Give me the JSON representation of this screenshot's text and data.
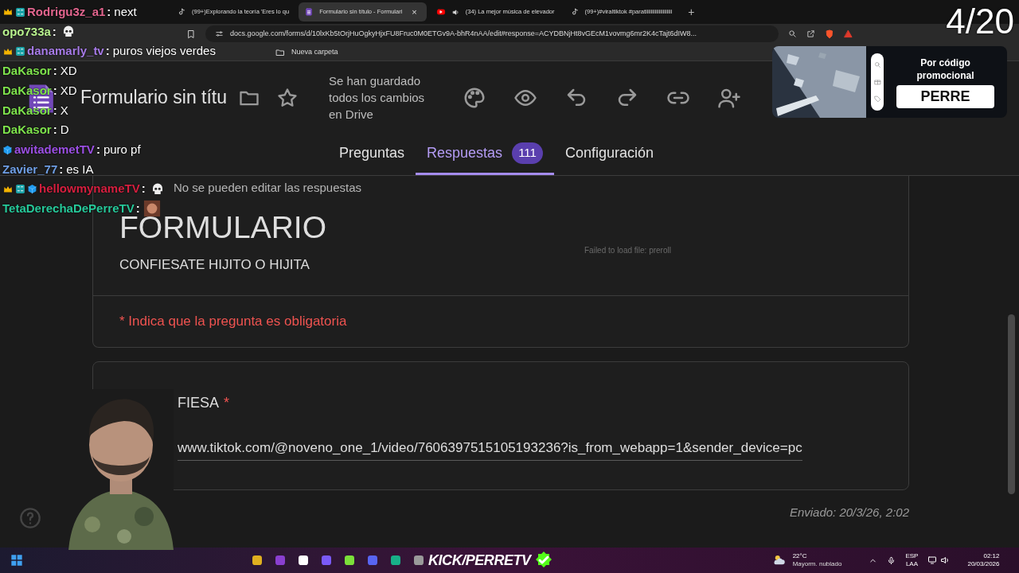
{
  "browser": {
    "tabs": [
      {
        "kind": "tiktok",
        "label": "(99+)Explorando la teoría 'Eres lo qu",
        "selected": false
      },
      {
        "kind": "forms",
        "label": "Formulario sin título - Formulari",
        "selected": true,
        "close": "×"
      },
      {
        "kind": "youtube",
        "label": "(34) La mejor música de elevador",
        "selected": false
      },
      {
        "kind": "tiktok",
        "label": "(99+)#viraltiktok #paratiiiiiiiiiiiiiiiiiiii",
        "selected": false
      }
    ],
    "new_tab": "+",
    "address": "docs.google.com/forms/d/10lxKb5tOrjHuOgkyHjxFU8Fruc0M0ETGv9A-bhR4nAA/edit#response=ACYDBNjHt8vGEcM1vovmg6mr2K4cTajt6dIW8...",
    "bookmarks": [
      "Nueva carpeta"
    ]
  },
  "form_header": {
    "title": "Formulario sin títu",
    "save_status": "Se han guardado todos los cambios en Drive",
    "tabs": [
      {
        "label": "Preguntas",
        "selected": false
      },
      {
        "label": "Respuestas",
        "selected": true,
        "count": "111"
      },
      {
        "label": "Configuración",
        "selected": false
      }
    ]
  },
  "response": {
    "note": "No se pueden editar las respuestas",
    "title": "FORMULARIO",
    "description": "CONFIESATE HIJITO O HIJITA",
    "required_note": "* Indica que la pregunta es obligatoria",
    "faint_message": "Failed to load file: preroll",
    "question": {
      "label": "FIESA",
      "required_mark": "*",
      "answer": "www.tiktok.com/@noveno_one_1/video/7606397515105193236?is_from_webapp=1&sender_device=pc"
    },
    "submitted": "Enviado: 20/3/26, 2:02"
  },
  "stream_overlay": {
    "chat": [
      {
        "user": "Rodrigu3z_a1",
        "color": "#e2658e",
        "separator": ":",
        "message": "next"
      },
      {
        "user": "opo733a",
        "color": "#b8f28e",
        "separator": ":"
      },
      {
        "user": "danamarly_tv",
        "color": "#a77be8",
        "separator": ":",
        "message": "puros viejos verdes"
      },
      {
        "user": "DaKasor",
        "color": "#7ee34c",
        "separator": ":",
        "message": "XD"
      },
      {
        "user": "DaKasor",
        "color": "#7ee34c",
        "separator": ":",
        "message": "XD"
      },
      {
        "user": "DaKasor",
        "color": "#7ee34c",
        "separator": ":",
        "message": "X"
      },
      {
        "user": "DaKasor",
        "color": "#7ee34c",
        "separator": ":",
        "message": "D"
      },
      {
        "user": "awitademetTV",
        "color": "#9b4fe3",
        "separator": ":",
        "message": "puro pf"
      },
      {
        "user": "Zavier_77",
        "color": "#6f9fe6",
        "separator": ":",
        "message": "es IA"
      },
      {
        "user": "hellowmynameTV",
        "color": "#d61f3f",
        "separator": ":"
      },
      {
        "user": "TetaDerechaDePerreTV",
        "color": "#26c99a",
        "separator": ":"
      }
    ],
    "counter": "4/20",
    "promo": {
      "line": "Por código promocional",
      "code": "PERRE"
    },
    "channel": "KICK/PERRETV"
  },
  "taskbar": {
    "temperature": "22°C",
    "weather": "Mayorm. nublado",
    "language": "ESP",
    "layout": "LAA",
    "time": "02:12",
    "date": "20/03/2026"
  }
}
